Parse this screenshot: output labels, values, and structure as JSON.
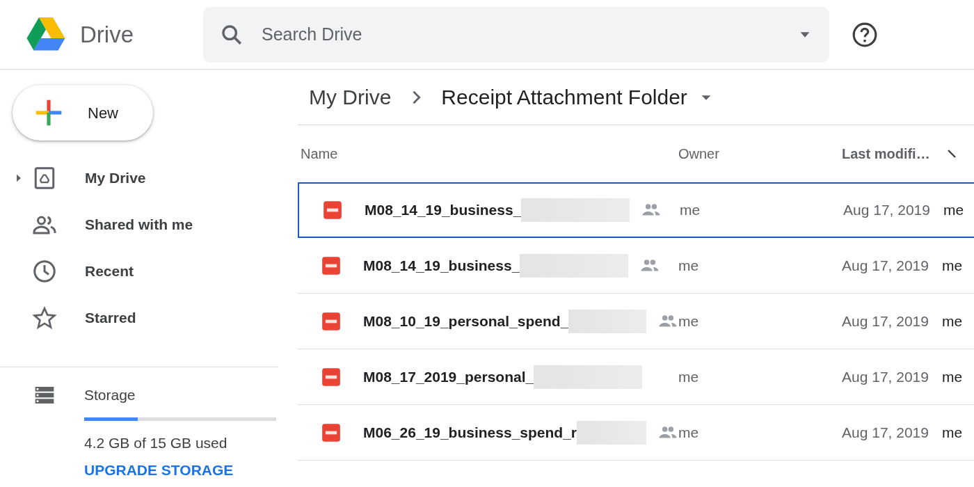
{
  "header": {
    "app_name": "Drive",
    "search": {
      "placeholder": "Search Drive"
    }
  },
  "sidebar": {
    "new_button": "New",
    "items": [
      {
        "label": "My Drive",
        "kind": "drive",
        "expandable": true,
        "selected": false
      },
      {
        "label": "Shared with me",
        "kind": "people",
        "expandable": false,
        "selected": false
      },
      {
        "label": "Recent",
        "kind": "clock",
        "expandable": false,
        "selected": false
      },
      {
        "label": "Starred",
        "kind": "star",
        "expandable": false,
        "selected": false
      }
    ],
    "storage": {
      "label": "Storage",
      "level": 0.28,
      "usage": "4.2 GB of 15 GB used",
      "upgrade_link": "UPGRADE STORAGE"
    }
  },
  "breadcrumb": [
    {
      "label": "My Drive",
      "current": false
    },
    {
      "label": "Receipt Attachment Folder",
      "current": true
    }
  ],
  "table": {
    "columns": [
      "Name",
      "Owner",
      "Last modifi…"
    ],
    "rows": [
      {
        "name": "M08_14_19_business_",
        "shared": true,
        "owner": "me",
        "modified": "Aug 17, 2019",
        "column_4": "me",
        "selected": true
      },
      {
        "name": "M08_14_19_business_",
        "shared": true,
        "owner": "me",
        "modified": "Aug 17, 2019",
        "column_4": "me",
        "selected": false
      },
      {
        "name": "M08_10_19_personal_spend_",
        "shared": true,
        "owner": "me",
        "modified": "Aug 17, 2019",
        "column_4": "me",
        "selected": false
      },
      {
        "name": "M08_17_2019_personal_",
        "shared": false,
        "owner": "me",
        "modified": "Aug 17, 2019",
        "column_4": "me",
        "selected": false
      },
      {
        "name": "M06_26_19_business_spend_r",
        "shared": true,
        "owner": "me",
        "modified": "Aug 17, 2019",
        "column_4": "me",
        "selected": false
      }
    ]
  }
}
